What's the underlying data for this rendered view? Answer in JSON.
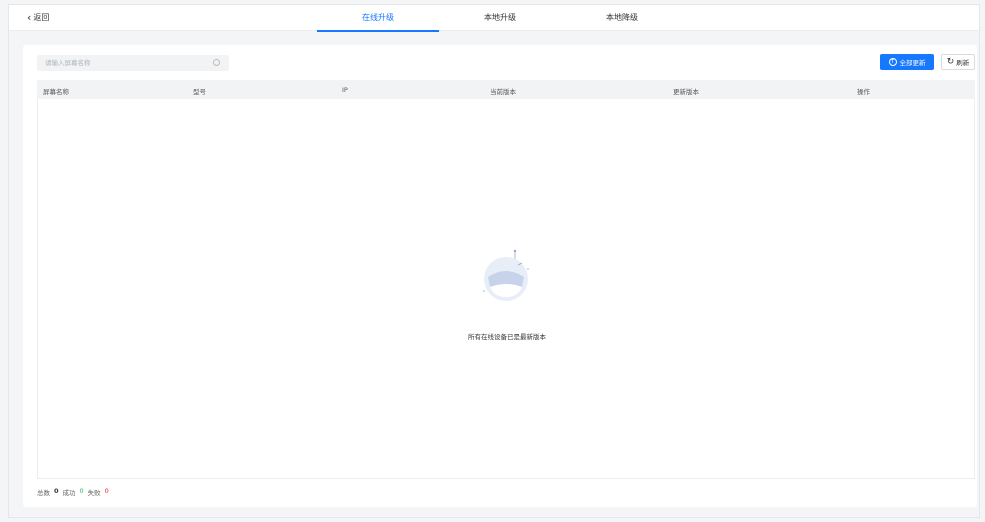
{
  "back_label": "返回",
  "tabs": [
    {
      "label": "在线升级",
      "active": true
    },
    {
      "label": "本地升级",
      "active": false
    },
    {
      "label": "本地降级",
      "active": false
    }
  ],
  "search": {
    "placeholder": "请输入屏幕名称"
  },
  "buttons": {
    "update_all": "全部更新",
    "refresh": "刷新"
  },
  "table": {
    "columns": [
      "屏幕名称",
      "型号",
      "IP",
      "当前版本",
      "更新版本",
      "操作"
    ]
  },
  "empty_message": "所有在线设备已是最新版本",
  "summary": {
    "total_label": "总数",
    "total_value": "0",
    "success_label": "成功",
    "success_value": "0",
    "fail_label": "失败",
    "fail_value": "0"
  },
  "colors": {
    "accent": "#1677ff",
    "success": "#2db55d",
    "fail": "#f5222d"
  }
}
